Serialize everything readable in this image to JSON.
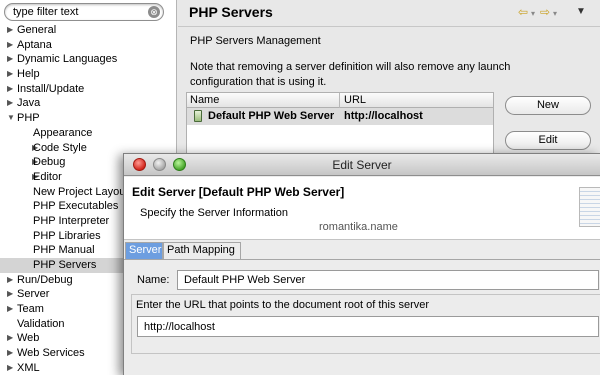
{
  "filter": {
    "placeholder": "type filter text",
    "value": "type filter text",
    "clear_glyph": "⊗"
  },
  "tree": [
    {
      "label": "General",
      "depth": 0,
      "expandable": true,
      "expanded": false
    },
    {
      "label": "Aptana",
      "depth": 0,
      "expandable": true,
      "expanded": false
    },
    {
      "label": "Dynamic Languages",
      "depth": 0,
      "expandable": true,
      "expanded": false
    },
    {
      "label": "Help",
      "depth": 0,
      "expandable": true,
      "expanded": false
    },
    {
      "label": "Install/Update",
      "depth": 0,
      "expandable": true,
      "expanded": false
    },
    {
      "label": "Java",
      "depth": 0,
      "expandable": true,
      "expanded": false
    },
    {
      "label": "PHP",
      "depth": 0,
      "expandable": true,
      "expanded": true
    },
    {
      "label": "Appearance",
      "depth": 1,
      "expandable": false
    },
    {
      "label": "Code Style",
      "depth": 1,
      "expandable": true,
      "expanded": false
    },
    {
      "label": "Debug",
      "depth": 1,
      "expandable": true,
      "expanded": false
    },
    {
      "label": "Editor",
      "depth": 1,
      "expandable": true,
      "expanded": false
    },
    {
      "label": "New Project Layou",
      "depth": 1,
      "expandable": false
    },
    {
      "label": "PHP Executables",
      "depth": 1,
      "expandable": false
    },
    {
      "label": "PHP Interpreter",
      "depth": 1,
      "expandable": false
    },
    {
      "label": "PHP Libraries",
      "depth": 1,
      "expandable": false
    },
    {
      "label": "PHP Manual",
      "depth": 1,
      "expandable": false
    },
    {
      "label": "PHP Servers",
      "depth": 1,
      "expandable": false,
      "selected": true
    },
    {
      "label": "Run/Debug",
      "depth": 0,
      "expandable": true,
      "expanded": false
    },
    {
      "label": "Server",
      "depth": 0,
      "expandable": true,
      "expanded": false
    },
    {
      "label": "Team",
      "depth": 0,
      "expandable": true,
      "expanded": false
    },
    {
      "label": "Validation",
      "depth": 0,
      "expandable": false
    },
    {
      "label": "Web",
      "depth": 0,
      "expandable": true,
      "expanded": false
    },
    {
      "label": "Web Services",
      "depth": 0,
      "expandable": true,
      "expanded": false
    },
    {
      "label": "XML",
      "depth": 0,
      "expandable": true,
      "expanded": false
    }
  ],
  "page": {
    "title": "PHP Servers",
    "nav_back": "⇦",
    "nav_back_drop": "▾",
    "nav_fwd": "⇨",
    "nav_fwd_drop": "▾",
    "menu": "▼",
    "management": "PHP Servers Management",
    "note": "Note that removing a server definition will also remove any launch configuration that is using it."
  },
  "table": {
    "headers": [
      "Name",
      "URL"
    ],
    "rows": [
      {
        "name": "Default PHP Web Server",
        "url": "http://localhost"
      }
    ]
  },
  "buttons": {
    "new": "New",
    "edit": "Edit"
  },
  "dialog": {
    "title": "Edit Server",
    "heading": "Edit Server [Default PHP Web Server]",
    "subheading": "Specify the Server Information",
    "watermark": "romantika.name",
    "tabs": [
      "Server",
      "Path Mapping"
    ],
    "name_label": "Name:",
    "name_value": "Default PHP Web Server",
    "url_description": "Enter the URL that points to the document root of this server",
    "url_value": "http://localhost"
  },
  "colors": {
    "selection": "#d4d4d4",
    "active_tab": "#6d9ee0"
  }
}
